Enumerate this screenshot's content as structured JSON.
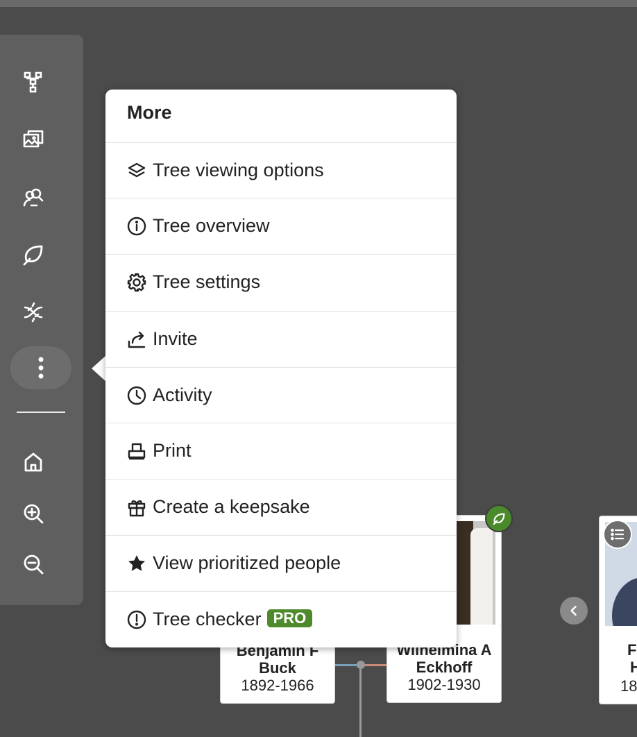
{
  "menu": {
    "title": "More",
    "items": [
      {
        "label": "Tree viewing options",
        "icon": "layers-icon"
      },
      {
        "label": "Tree overview",
        "icon": "info-icon"
      },
      {
        "label": "Tree settings",
        "icon": "gear-icon"
      },
      {
        "label": "Invite",
        "icon": "share-icon"
      },
      {
        "label": "Activity",
        "icon": "clock-icon"
      },
      {
        "label": "Print",
        "icon": "print-icon"
      },
      {
        "label": "Create a keepsake",
        "icon": "gift-icon"
      },
      {
        "label": "View prioritized people",
        "icon": "star-icon"
      },
      {
        "label": "Tree checker",
        "icon": "alert-icon",
        "badge": "PRO"
      }
    ]
  },
  "toolbar": {
    "tools": [
      "tree-view-icon",
      "media-gallery-icon",
      "people-search-icon",
      "hints-leaf-icon",
      "dna-icon",
      "more-icon",
      "home-icon",
      "zoom-in-icon",
      "zoom-out-icon"
    ]
  },
  "tree": {
    "people": [
      {
        "name_line1": "Benjamin F",
        "name_line2": "Buck",
        "years": "1892-1966"
      },
      {
        "name_line1": "Wilhelmina A",
        "name_line2": "Eckhoff",
        "years": "1902-1930"
      },
      {
        "name_line1": "F",
        "name_line2": "H",
        "years": "18"
      }
    ]
  },
  "colors": {
    "background": "#4b4b4b",
    "toolbar": "#5f5f5f",
    "pro_badge": "#4e8a2b",
    "hint_badge": "#4a8a2a"
  }
}
